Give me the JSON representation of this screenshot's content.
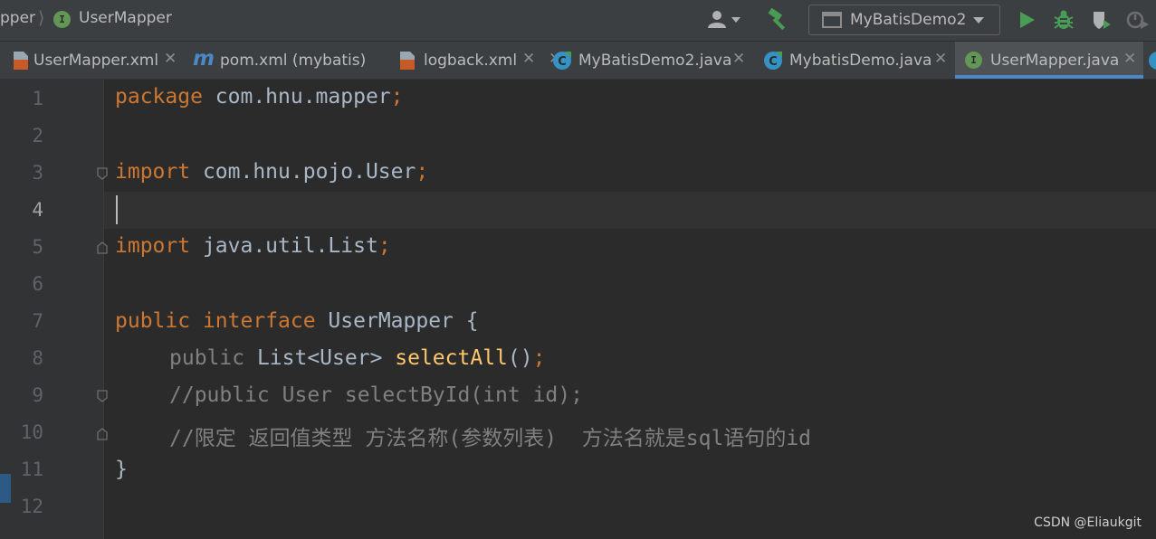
{
  "breadcrumb": {
    "parent": "pper",
    "separator": "⟩",
    "current": "UserMapper"
  },
  "toolbar": {
    "user_icon": "user-dropdown-icon",
    "build_icon": "hammer-icon",
    "run_config": "MyBatisDemo2",
    "run_icon": "run-icon",
    "debug_icon": "bug-icon",
    "coverage_icon": "coverage-shield-icon",
    "profile_icon": "profiler-icon"
  },
  "tabs": [
    {
      "label": "UserMapper.xml",
      "icon": "xml-file-icon",
      "active": false
    },
    {
      "label": "pom.xml (mybatis)",
      "icon": "maven-icon",
      "active": false
    },
    {
      "label": "logback.xml",
      "icon": "xml-file-icon",
      "active": false
    },
    {
      "label": "MyBatisDemo2.java",
      "icon": "java-class-icon",
      "active": false
    },
    {
      "label": "MybatisDemo.java",
      "icon": "java-class-icon",
      "active": false
    },
    {
      "label": "UserMapper.java",
      "icon": "java-interface-icon",
      "active": true
    }
  ],
  "tab_close_glyph": "✕",
  "interface_icon_letter": "I",
  "editor": {
    "line_numbers": [
      "1",
      "2",
      "3",
      "4",
      "5",
      "6",
      "7",
      "8",
      "9",
      "10",
      "11",
      "12"
    ],
    "current_line": 4
  },
  "code": {
    "l1_kw": "package",
    "l1_rest": " com.hnu.mapper",
    "l1_semi": ";",
    "l3_kw": "import",
    "l3_rest": " com.hnu.pojo.User",
    "l3_semi": ";",
    "l5_kw": "import",
    "l5_rest": " java.util.List",
    "l5_semi": ";",
    "l7_kw1": "public",
    "l7_kw2": "interface",
    "l7_rest": " UserMapper {",
    "l8_kw": "public",
    "l8_type": " List<User> ",
    "l8_fn": "selectAll",
    "l8_paren": "()",
    "l8_semi": ";",
    "l9": "//public User selectById(int id);",
    "l10": "//限定 返回值类型 方法名称(参数列表)  方法名就是sql语句的id",
    "l11": "}"
  },
  "watermark": "CSDN @Eliaukgit",
  "colors": {
    "keyword": "#cc7832",
    "method": "#ffc66d",
    "comment": "#808080",
    "text": "#a9b7c6",
    "accent": "#4a88c7",
    "interface_icon": "#629755"
  }
}
